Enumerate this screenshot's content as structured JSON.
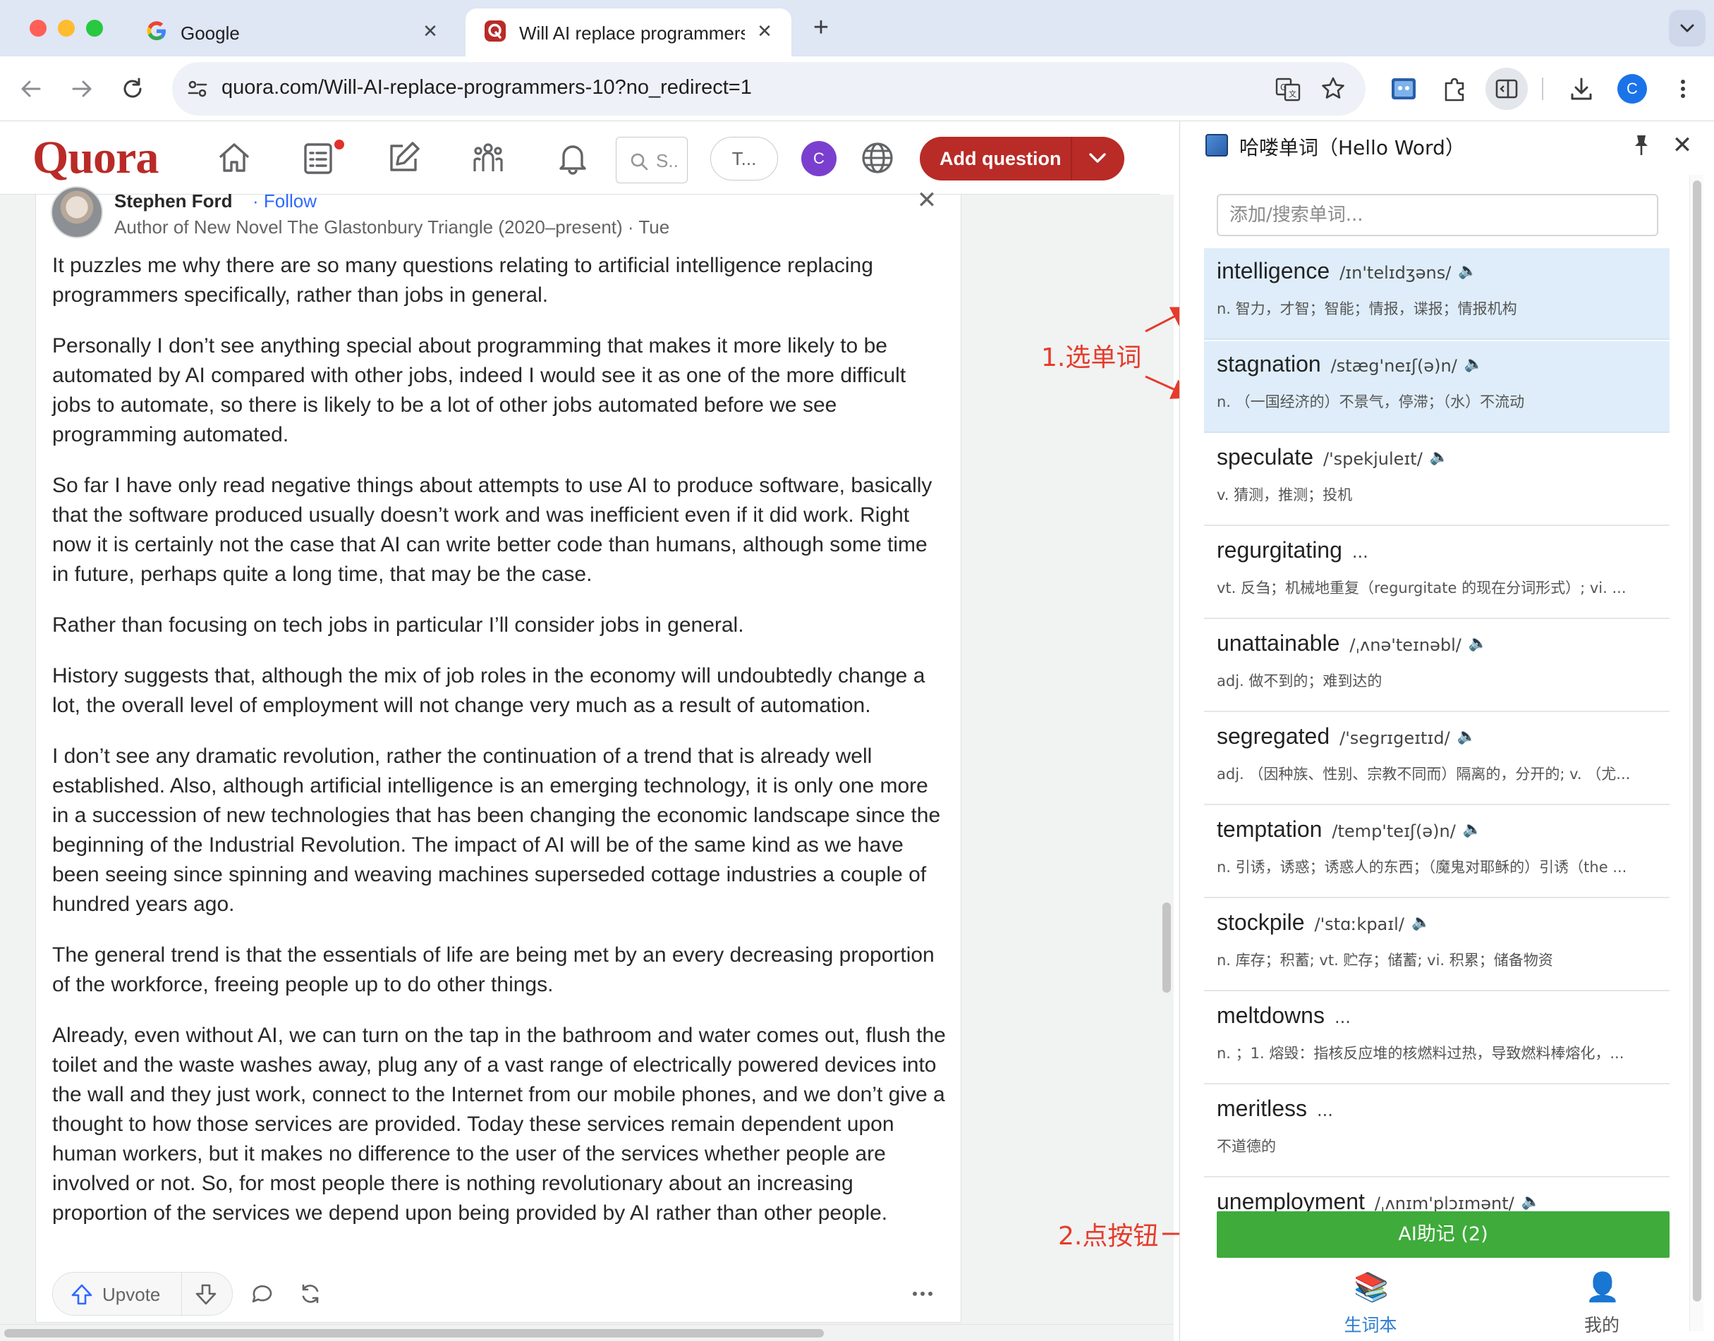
{
  "browser": {
    "tabs": [
      {
        "title": "Google",
        "favicon": "google-g-icon",
        "active": false
      },
      {
        "title": "Will AI replace programmers?",
        "favicon": "quora-q-icon",
        "active": true
      }
    ],
    "url": "quora.com/Will-AI-replace-programmers-10?no_redirect=1",
    "profile_initial": "C"
  },
  "quora": {
    "logo": "Quora",
    "search_placeholder": "S..",
    "try_label": "T...",
    "avatar_initial": "C",
    "add_question_label": "Add question",
    "notification_dot_color": "#e0312c"
  },
  "answer": {
    "author_name": "Stephen Ford",
    "follow_label": "· Follow",
    "credential": "Author of New Novel The Glastonbury Triangle (2020–present) · Tue",
    "paragraphs": [
      "It puzzles me why there are so many questions relating to artificial intelligence replacing programmers specifically, rather than jobs in general.",
      "Personally I don’t see anything special about programming that makes it more likely to be automated by AI compared with other jobs, indeed I would see it as one of the more difficult jobs to automate, so there is likely to be a lot of other jobs automated before we see programming automated.",
      "So far I have only read negative things about attempts to use AI to produce software, basically that the software produced usually doesn’t work and was inefficient even if it did work. Right now it is certainly not the case that AI can write better code than humans, although some time in future, perhaps quite a long time, that may be the case.",
      "Rather than focusing on tech jobs in particular I’ll consider jobs in general.",
      "History suggests that, although the mix of job roles in the economy will undoubtedly change a lot, the overall level of employment will not change very much as a result of automation.",
      "I don’t see any dramatic revolution, rather the continuation of a trend that is already well established. Also, although artificial intelligence is an emerging technology, it is only one more in a succession of new technologies that has been changing the economic landscape since the beginning of the Industrial Revolution. The impact of AI will be of the same kind as we have been seeing since spinning and weaving machines superseded cottage industries a couple of hundred years ago.",
      "The general trend is that the essentials of life are being met by an every decreasing proportion of the workforce, freeing people up to do other things.",
      "Already, even without AI, we can turn on the tap in the bathroom and water comes out, flush the toilet and the waste washes away, plug any of a vast range of electrically powered devices into the wall and they just work, connect to the Internet from our mobile phones, and we don’t give a thought to how those services are provided. Today these services remain dependent upon human workers, but it makes no difference to the user of the services whether people are involved or not. So, for most people there is nothing revolutionary about an increasing proportion of the services we depend upon being provided by AI rather than other people."
    ],
    "upvote_label": "Upvote"
  },
  "annotations": {
    "select_words": "1.选单词",
    "click_button": "2.点按钮",
    "color": "#e53c2b"
  },
  "side_panel": {
    "title": "哈喽单词（Hello Word）",
    "search_placeholder": "添加/搜索单词...",
    "words": [
      {
        "word": "intelligence",
        "phonetic": "/ɪn'telɪdʒəns/",
        "speaker": true,
        "def": "n. 智力，才智；智能；情报，谍报；情报机构",
        "selected": true
      },
      {
        "word": "stagnation",
        "phonetic": "/stæg'neɪʃ(ə)n/",
        "speaker": true,
        "def": "n. （一国经济的）不景气，停滞；（水）不流动",
        "selected": true
      },
      {
        "word": "speculate",
        "phonetic": "/'spekjuleɪt/",
        "speaker": true,
        "def": "v. 猜测，推测；投机",
        "selected": false
      },
      {
        "word": "regurgitating",
        "phonetic": "...",
        "speaker": false,
        "def": "vt. 反刍；机械地重复（regurgitate 的现在分词形式）; vi. ...",
        "selected": false
      },
      {
        "word": "unattainable",
        "phonetic": "/ˌʌnə'teɪnəbl/",
        "speaker": true,
        "def": "adj. 做不到的；难到达的",
        "selected": false
      },
      {
        "word": "segregated",
        "phonetic": "/'segrɪgeɪtɪd/",
        "speaker": true,
        "def": "adj. （因种族、性别、宗教不同而）隔离的，分开的; v. （尤...",
        "selected": false
      },
      {
        "word": "temptation",
        "phonetic": "/temp'teɪʃ(ə)n/",
        "speaker": true,
        "def": "n. 引诱，诱惑；诱惑人的东西；（魔鬼对耶稣的）引诱（the ...",
        "selected": false
      },
      {
        "word": "stockpile",
        "phonetic": "/'stɑːkpaɪl/",
        "speaker": true,
        "def": "n. 库存；积蓄; vt. 贮存；储蓄; vi. 积累；储备物资",
        "selected": false
      },
      {
        "word": "meltdowns",
        "phonetic": "...",
        "speaker": false,
        "def": "n. ；1. 熔毁：指核反应堆的核燃料过热，导致燃料棒熔化，...",
        "selected": false
      },
      {
        "word": "meritless",
        "phonetic": "...",
        "speaker": false,
        "def": "不道德的",
        "selected": false
      },
      {
        "word": "unemployment",
        "phonetic": "/ˌʌnɪm'plɔɪmənt/",
        "speaker": true,
        "def": "",
        "selected": false
      }
    ],
    "ai_button_label": "AI助记 (2)",
    "ai_button_color": "#3eab3b",
    "tabs": [
      {
        "label": "生词本",
        "icon": "books-icon",
        "active": true
      },
      {
        "label": "我的",
        "icon": "user-icon",
        "active": false
      }
    ],
    "active_tab_color": "#2e7dd1"
  }
}
